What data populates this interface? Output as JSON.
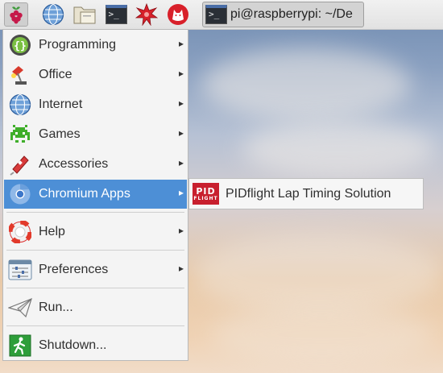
{
  "taskbar": {
    "launchers": [
      {
        "name": "raspberry-menu-icon"
      },
      {
        "name": "web-browser-icon"
      },
      {
        "name": "file-manager-icon"
      },
      {
        "name": "terminal-icon"
      },
      {
        "name": "mathematica-icon"
      },
      {
        "name": "wolfram-icon"
      }
    ],
    "task_title": "pi@raspberrypi: ~/De"
  },
  "menu": {
    "items": [
      {
        "label": "Programming",
        "icon": "programming-icon",
        "submenu": true
      },
      {
        "label": "Office",
        "icon": "office-icon",
        "submenu": true
      },
      {
        "label": "Internet",
        "icon": "internet-icon",
        "submenu": true
      },
      {
        "label": "Games",
        "icon": "games-icon",
        "submenu": true
      },
      {
        "label": "Accessories",
        "icon": "accessories-icon",
        "submenu": true
      },
      {
        "label": "Chromium Apps",
        "icon": "chromium-icon",
        "submenu": true,
        "selected": true
      },
      {
        "label": "Help",
        "icon": "help-icon",
        "submenu": true
      },
      {
        "label": "Preferences",
        "icon": "preferences-icon",
        "submenu": true
      },
      {
        "label": "Run...",
        "icon": "run-icon",
        "submenu": false
      },
      {
        "label": "Shutdown...",
        "icon": "shutdown-icon",
        "submenu": false
      }
    ]
  },
  "submenu": {
    "items": [
      {
        "label": "PIDflight Lap Timing Solution",
        "logo_top": "PID",
        "logo_bottom": "FLIGHT",
        "icon": "pidflight-icon"
      }
    ]
  },
  "colors": {
    "selection": "#4d8fd6",
    "menu_bg": "#f4f4f4",
    "pid_red": "#c81f2e"
  }
}
